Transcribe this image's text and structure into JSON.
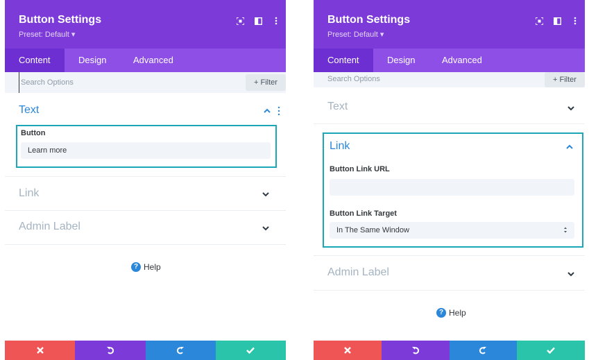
{
  "colors": {
    "header": "#7c3ad9",
    "tabs": "#8e4fe6",
    "active_tab": "#6d2fd1",
    "accent_blue": "#2b87da",
    "highlight": "#1aa8b8",
    "discard": "#ef5555",
    "undo": "#7c3ad9",
    "redo": "#2b87da",
    "save": "#29c4a9"
  },
  "left": {
    "header": {
      "title": "Button Settings",
      "preset": "Preset: Default ▾",
      "icons": [
        "focus-icon",
        "split-view-icon",
        "kebab-menu-icon"
      ]
    },
    "tabs": [
      "Content",
      "Design",
      "Advanced"
    ],
    "search": {
      "placeholder": "Search Options",
      "filter": "+ Filter"
    },
    "sections": {
      "text": {
        "title": "Text",
        "field_label": "Button",
        "field_value": "Learn more"
      },
      "link": {
        "title": "Link"
      },
      "admin": {
        "title": "Admin Label"
      }
    },
    "help": "Help"
  },
  "right": {
    "header": {
      "title": "Button Settings",
      "preset": "Preset: Default ▾",
      "icons": [
        "focus-icon",
        "split-view-icon",
        "kebab-menu-icon"
      ]
    },
    "tabs": [
      "Content",
      "Design",
      "Advanced"
    ],
    "search": {
      "placeholder": "Search Options",
      "filter": "+ Filter"
    },
    "sections": {
      "text": {
        "title": "Text"
      },
      "link": {
        "title": "Link",
        "url_label": "Button Link URL",
        "url_value": "",
        "target_label": "Button Link Target",
        "target_value": "In The Same Window"
      },
      "admin": {
        "title": "Admin Label"
      }
    },
    "help": "Help"
  },
  "footer_icons": [
    "close-icon",
    "undo-icon",
    "redo-icon",
    "check-icon"
  ]
}
